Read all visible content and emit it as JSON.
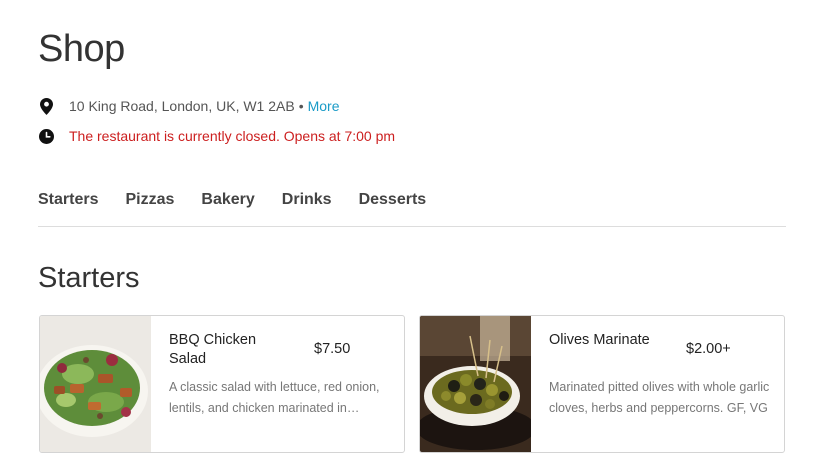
{
  "shop": {
    "title": "Shop"
  },
  "info": {
    "address": "10 King Road, London, UK, W1 2AB",
    "separator": "•",
    "more_label": "More",
    "status": "The restaurant is currently closed. Opens at 7:00 pm"
  },
  "tabs": [
    {
      "label": "Starters"
    },
    {
      "label": "Pizzas"
    },
    {
      "label": "Bakery"
    },
    {
      "label": "Drinks"
    },
    {
      "label": "Desserts"
    }
  ],
  "section": {
    "title": "Starters"
  },
  "items": [
    {
      "name": "BBQ Chicken Salad",
      "price": "$7.50",
      "description": "A classic salad with lettuce, red onion, lentils, and chicken marinated in…"
    },
    {
      "name": "Olives Marinate",
      "price": "$2.00+",
      "description": "Marinated pitted olives with whole garlic cloves, herbs and peppercorns. GF, VG"
    }
  ],
  "colors": {
    "accent": "#1a9bc7",
    "closed": "#cc1f1f",
    "text": "#333333",
    "muted": "#777777"
  },
  "icons": {
    "address": "map-pin-icon",
    "hours": "clock-icon"
  }
}
